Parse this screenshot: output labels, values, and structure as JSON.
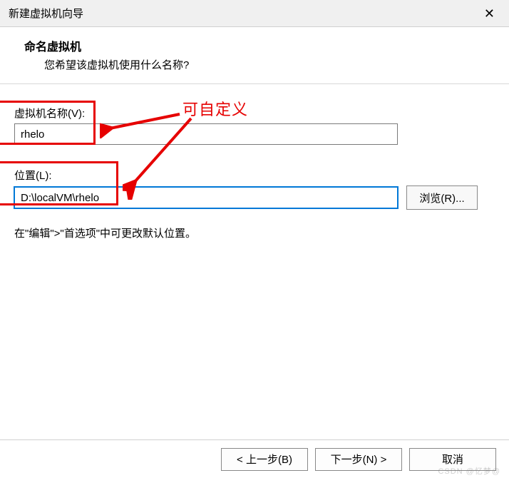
{
  "window": {
    "title": "新建虚拟机向导"
  },
  "header": {
    "title": "命名虚拟机",
    "subtitle": "您希望该虚拟机使用什么名称?"
  },
  "fields": {
    "name_label": "虚拟机名称(V):",
    "name_value": "rhelo",
    "location_label": "位置(L):",
    "location_value": "D:\\localVM\\rhelo",
    "browse_label": "浏览(R)..."
  },
  "hint": "在\"编辑\">\"首选项\"中可更改默认位置。",
  "annotation": {
    "text": "可自定义"
  },
  "footer": {
    "back": "< 上一步(B)",
    "next": "下一步(N) >",
    "cancel": "取消"
  },
  "watermark": "CSDN @忆梦@"
}
